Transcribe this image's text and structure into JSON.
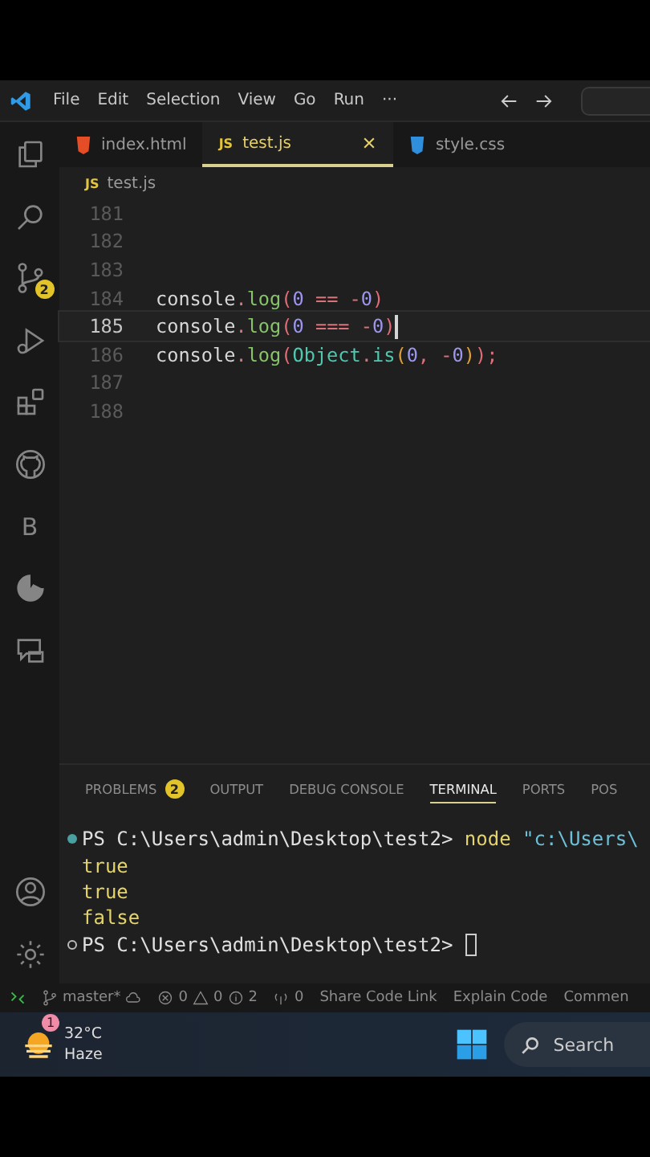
{
  "menu": [
    "File",
    "Edit",
    "Selection",
    "View",
    "Go",
    "Run",
    "···"
  ],
  "activity_bar": [
    {
      "kind": "files"
    },
    {
      "kind": "search"
    },
    {
      "kind": "scm",
      "badge": "2"
    },
    {
      "kind": "run"
    },
    {
      "kind": "extensions"
    },
    {
      "kind": "github"
    },
    {
      "kind": "letter",
      "label": "B"
    },
    {
      "kind": "pie"
    },
    {
      "kind": "remote"
    }
  ],
  "activity_bar_bottom": [
    {
      "kind": "account"
    },
    {
      "kind": "settings"
    }
  ],
  "tabs": [
    {
      "kind": "html",
      "label": "index.html",
      "selected": false
    },
    {
      "kind": "js",
      "icon_text": "JS",
      "label": "test.js",
      "selected": true
    },
    {
      "kind": "css",
      "label": "style.css",
      "selected": false
    }
  ],
  "breadcrumb": {
    "kind": "js",
    "icon_text": "JS",
    "label": "test.js"
  },
  "editor": {
    "lines": [
      {
        "number": "181",
        "current": false
      },
      {
        "number": "182",
        "current": false
      },
      {
        "number": "183",
        "current": false
      },
      {
        "number": "184",
        "current": false,
        "tokens": [
          {
            "kind": "ident",
            "text": "console"
          },
          {
            "kind": "op",
            "text": "."
          },
          {
            "kind": "method",
            "text": "log"
          },
          {
            "kind": "paren",
            "text": "("
          },
          {
            "kind": "num",
            "text": "0"
          },
          {
            "kind": "op",
            "text": " == -"
          },
          {
            "kind": "num",
            "text": "0"
          },
          {
            "kind": "paren",
            "text": ")"
          }
        ]
      },
      {
        "number": "185",
        "current": true,
        "tokens": [
          {
            "kind": "ident",
            "text": "console"
          },
          {
            "kind": "op",
            "text": "."
          },
          {
            "kind": "method",
            "text": "log"
          },
          {
            "kind": "paren",
            "text": "("
          },
          {
            "kind": "num",
            "text": "0"
          },
          {
            "kind": "op",
            "text": " === -"
          },
          {
            "kind": "num",
            "text": "0"
          },
          {
            "kind": "paren",
            "text": ")"
          }
        ]
      },
      {
        "number": "186",
        "current": false,
        "tokens": [
          {
            "kind": "ident",
            "text": "console"
          },
          {
            "kind": "op",
            "text": "."
          },
          {
            "kind": "method",
            "text": "log"
          },
          {
            "kind": "paren",
            "text": "("
          },
          {
            "kind": "class",
            "text": "Object"
          },
          {
            "kind": "op",
            "text": "."
          },
          {
            "kind": "class",
            "text": "is"
          },
          {
            "kind": "paren2",
            "text": "("
          },
          {
            "kind": "num",
            "text": "0"
          },
          {
            "kind": "op",
            "text": ", -"
          },
          {
            "kind": "num",
            "text": "0"
          },
          {
            "kind": "paren2",
            "text": ")"
          },
          {
            "kind": "paren",
            "text": ")"
          },
          {
            "kind": "op",
            "text": ";"
          }
        ]
      },
      {
        "number": "187",
        "current": false
      },
      {
        "number": "188",
        "current": false
      }
    ]
  },
  "panel": {
    "tabs": [
      {
        "label": "PROBLEMS",
        "badge": "2",
        "selected": false
      },
      {
        "label": "OUTPUT",
        "selected": false
      },
      {
        "label": "DEBUG CONSOLE",
        "selected": false
      },
      {
        "label": "TERMINAL",
        "selected": true
      },
      {
        "label": "PORTS",
        "selected": false
      },
      {
        "label": "POS",
        "selected": false
      }
    ],
    "terminal": [
      {
        "kind": "command",
        "finished": true,
        "tokens": [
          {
            "kind": "prompt",
            "text": "PS C:\\Users\\admin\\Desktop\\test2> "
          },
          {
            "kind": "cmd",
            "text": "node"
          },
          {
            "kind": "string",
            "text": " \"c:\\Users\\"
          }
        ]
      },
      {
        "kind": "output",
        "text": "true"
      },
      {
        "kind": "output",
        "text": "true"
      },
      {
        "kind": "output",
        "text": "false"
      },
      {
        "kind": "command",
        "finished": false,
        "cursor": true,
        "tokens": [
          {
            "kind": "prompt",
            "text": "PS C:\\Users\\admin\\Desktop\\test2> "
          }
        ]
      }
    ]
  },
  "status_bar": {
    "branch": "master*",
    "errors": "0",
    "warnings": "0",
    "infos": "2",
    "ports": "0",
    "items": [
      "Share Code Link",
      "Explain Code",
      "Commen"
    ]
  },
  "taskbar": {
    "weather": {
      "badge": "1",
      "temperature": "32°C",
      "condition": "Haze"
    },
    "search": {
      "placeholder": "Search"
    }
  }
}
